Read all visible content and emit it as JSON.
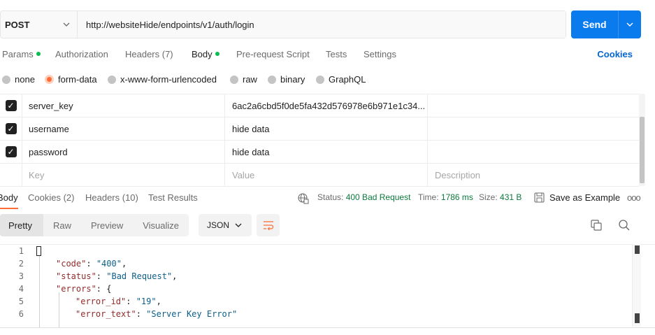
{
  "request": {
    "method": "POST",
    "url": "http://websiteHide/endpoints/v1/auth/login",
    "send_label": "Send"
  },
  "request_tabs": [
    {
      "label": "Params",
      "dot": true
    },
    {
      "label": "Authorization",
      "dot": false
    },
    {
      "label": "Headers (7)",
      "dot": false
    },
    {
      "label": "Body",
      "dot": true,
      "active": true
    },
    {
      "label": "Pre-request Script",
      "dot": false
    },
    {
      "label": "Tests",
      "dot": false
    },
    {
      "label": "Settings",
      "dot": false
    }
  ],
  "cookies_label": "Cookies",
  "body_types": [
    {
      "label": "none",
      "selected": false
    },
    {
      "label": "form-data",
      "selected": true
    },
    {
      "label": "x-www-form-urlencoded",
      "selected": false
    },
    {
      "label": "raw",
      "selected": false
    },
    {
      "label": "binary",
      "selected": false
    },
    {
      "label": "GraphQL",
      "selected": false
    }
  ],
  "params": [
    {
      "checked": true,
      "key": "server_key",
      "value": "6ac2a6cbd5f0de5fa432d576978e6b971e1c34...",
      "description": ""
    },
    {
      "checked": true,
      "key": "username",
      "value": "hide data",
      "description": ""
    },
    {
      "checked": true,
      "key": "password",
      "value": "hide data",
      "description": ""
    }
  ],
  "params_placeholder": {
    "key": "Key",
    "value": "Value",
    "description": "Description"
  },
  "response_tabs": [
    {
      "label": "Body",
      "active": true
    },
    {
      "label": "Cookies (2)"
    },
    {
      "label": "Headers (10)"
    },
    {
      "label": "Test Results"
    }
  ],
  "response_meta": {
    "status_label": "Status:",
    "status_value": "400 Bad Request",
    "time_label": "Time:",
    "time_value": "1786 ms",
    "size_label": "Size:",
    "size_value": "431 B",
    "save_label": "Save as Example",
    "more_label": "ooo"
  },
  "view_tabs": [
    "Pretty",
    "Raw",
    "Preview",
    "Visualize"
  ],
  "format_label": "JSON",
  "code_lines": [
    "1",
    "2",
    "3",
    "4",
    "5",
    "6"
  ],
  "code": {
    "code_key": "\"code\"",
    "code_val": "\"400\"",
    "status_key": "\"status\"",
    "status_val": "\"Bad Request\"",
    "errors_key": "\"errors\"",
    "error_id_key": "\"error_id\"",
    "error_id_val": "\"19\"",
    "error_text_key": "\"error_text\"",
    "error_text_val": "\"Server Key Error\""
  },
  "colors": {
    "accent": "#097bed",
    "brand": "#ff6c37",
    "status_ok_text": "#0c7a3d",
    "dot": "#0cbb52"
  }
}
